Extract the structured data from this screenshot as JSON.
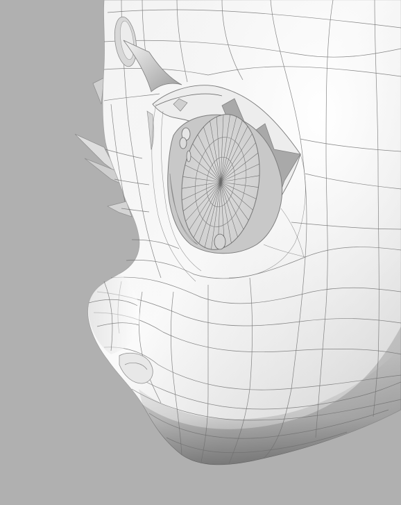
{
  "scene": {
    "subject": "3d-character-head-wireframe",
    "colors": {
      "background": "#b0b0b0",
      "surface_light": "#fbfbfb",
      "surface_mid": "#e4e4e4",
      "surface_shadow": "#8a8a8a",
      "wire": "#6f6f6f",
      "eye_socket": "#d6d6d6"
    }
  }
}
